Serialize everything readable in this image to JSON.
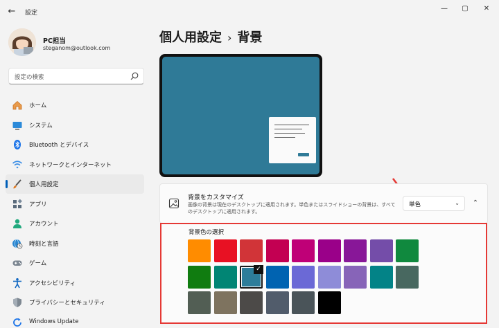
{
  "window": {
    "title": "設定",
    "back": "←",
    "minimize": "—",
    "maximize": "▢",
    "close": "✕"
  },
  "user": {
    "name": "PC担当",
    "email": "steganom@outlook.com"
  },
  "search": {
    "placeholder": "設定の検索"
  },
  "nav": [
    {
      "label": "ホーム",
      "icon": "home-icon",
      "color": "#d9822b"
    },
    {
      "label": "システム",
      "icon": "system-icon",
      "color": "#0078d4"
    },
    {
      "label": "Bluetooth とデバイス",
      "icon": "bluetooth-icon",
      "color": "#0078d4"
    },
    {
      "label": "ネットワークとインターネット",
      "icon": "wifi-icon",
      "color": "#0078d4"
    },
    {
      "label": "個人用設定",
      "icon": "brush-icon",
      "color": "#e07a20",
      "active": true
    },
    {
      "label": "アプリ",
      "icon": "apps-icon",
      "color": "#4a5a6a"
    },
    {
      "label": "アカウント",
      "icon": "account-icon",
      "color": "#1aa37a"
    },
    {
      "label": "時刻と言語",
      "icon": "globe-clock-icon",
      "color": "#1f7fc4"
    },
    {
      "label": "ゲーム",
      "icon": "gamepad-icon",
      "color": "#6b7580"
    },
    {
      "label": "アクセシビリティ",
      "icon": "accessibility-icon",
      "color": "#0f6cbd"
    },
    {
      "label": "プライバシーとセキュリティ",
      "icon": "shield-icon",
      "color": "#6b7580"
    },
    {
      "label": "Windows Update",
      "icon": "update-icon",
      "color": "#0078d4"
    }
  ],
  "page": {
    "section": "個人用設定",
    "separator": "›",
    "title": "背景"
  },
  "background_card": {
    "title": "背景をカスタマイズ",
    "description": "画像の背景は現在のデスクトップに適用されます。単色またはスライドショーの背景は、すべてのデスクトップに適用されます。",
    "dropdown_value": "単色",
    "chevron_down": "⌄",
    "collapse": "⌃"
  },
  "color_picker": {
    "title": "背景色の選択",
    "check": "✓",
    "colors": [
      [
        "#ff8c00",
        "#e81123",
        "#d13438",
        "#c30052",
        "#bf0077",
        "#9a0089",
        "#881798",
        "#744da9",
        "#10893e"
      ],
      [
        "#107c10",
        "#018574",
        "#2d7d9a",
        "#0063b1",
        "#6b69d6",
        "#8e8cd8",
        "#8764b8",
        "#038387",
        "#486860"
      ],
      [
        "#525e54",
        "#7e735f",
        "#4c4a48",
        "#515c6b",
        "#4a5459",
        "#000000"
      ]
    ],
    "selected": {
      "row": 1,
      "col": 2
    }
  },
  "colors": {
    "accent": "#005fb8",
    "highlight_border": "#e53935",
    "preview": "#2f7a97"
  }
}
